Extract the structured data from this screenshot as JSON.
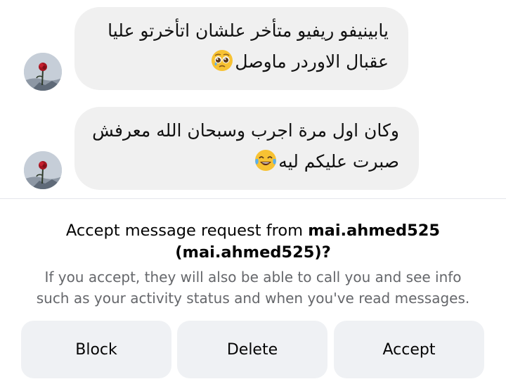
{
  "conversation": {
    "messages": [
      {
        "lines": [
          "يابينيفو ريفيو متأخر علشان اتأخرتو عليا",
          "عقبال الاوردر ماوصل"
        ],
        "emoji": "pleading-face-emoji"
      },
      {
        "lines": [
          "وكان اول مرة اجرب وسبحان الله معرفش",
          "صبرت عليكم ليه"
        ],
        "emoji": "tears-of-joy-emoji"
      }
    ]
  },
  "request": {
    "title_prefix": "Accept message request from ",
    "username": "mai.ahmed525",
    "title_open_paren": "(",
    "username_repeat": "mai.ahmed525",
    "title_close": ")?",
    "description_line1": "If you accept, they will also be able to call you and see info",
    "description_line2": "such as your activity status and when you've read messages."
  },
  "actions": {
    "block_label": "Block",
    "delete_label": "Delete",
    "accept_label": "Accept"
  },
  "colors": {
    "bubble_bg": "#f0f0f0",
    "button_bg": "#eff1f4",
    "secondary_text": "#65676b",
    "primary_text": "#050505"
  }
}
